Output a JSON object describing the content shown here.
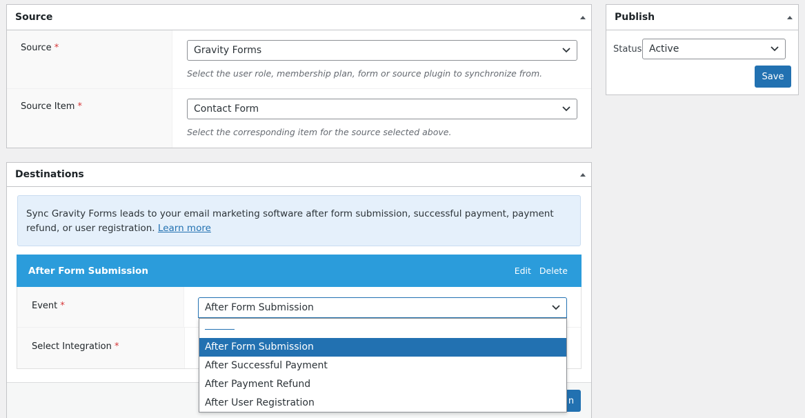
{
  "source_box": {
    "title": "Source",
    "rows": [
      {
        "label": "Source",
        "required": "*",
        "value": "Gravity Forms",
        "description": "Select the user role, membership plan, form or source plugin to synchronize from."
      },
      {
        "label": "Source Item",
        "required": "*",
        "value": "Contact Form",
        "description": "Select the corresponding item for the source selected above."
      }
    ]
  },
  "publish_box": {
    "title": "Publish",
    "status_label": "Status:",
    "status_value": "Active",
    "save_label": "Save"
  },
  "destinations_box": {
    "title": "Destinations",
    "notice_text": "Sync Gravity Forms leads to your email marketing software after form submission, successful payment, payment refund, or user registration.",
    "notice_link": "Learn more",
    "action": {
      "title": "After Form Submission",
      "edit_label": "Edit",
      "delete_label": "Delete"
    },
    "event_label": "Event",
    "event_required": "*",
    "event_value": "After Form Submission",
    "integration_label": "Select Integration",
    "integration_required": "*",
    "partial_button_label": "n"
  },
  "event_dropdown": {
    "options": [
      "After Form Submission",
      "After Successful Payment",
      "After Payment Refund",
      "After User Registration"
    ],
    "selected_index": 0
  },
  "colors": {
    "accent": "#2271b1",
    "action_bar": "#2b9cdb",
    "notice_bg": "#e5f0fb",
    "required": "#d63638"
  }
}
